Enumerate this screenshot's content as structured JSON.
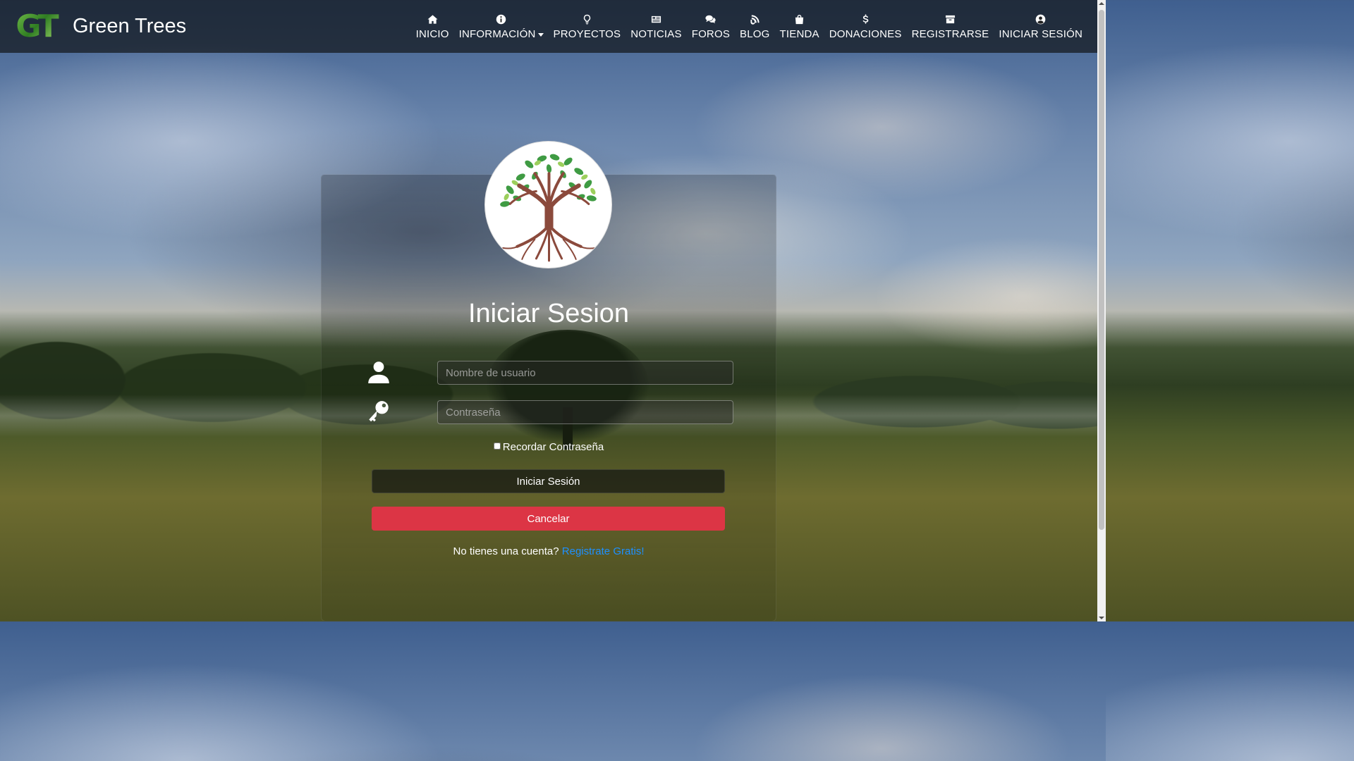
{
  "brand": {
    "logo_text": "GT",
    "name": "Green Trees"
  },
  "nav": {
    "items": [
      {
        "label": "INICIO",
        "icon": "home-icon"
      },
      {
        "label": "INFORMACIÓN",
        "icon": "info-icon",
        "dropdown": true
      },
      {
        "label": "PROYECTOS",
        "icon": "lightbulb-icon"
      },
      {
        "label": "NOTICIAS",
        "icon": "newspaper-icon"
      },
      {
        "label": "FOROS",
        "icon": "comments-icon"
      },
      {
        "label": "BLOG",
        "icon": "blog-icon"
      },
      {
        "label": "TIENDA",
        "icon": "shopping-bag-icon"
      },
      {
        "label": "DONACIONES",
        "icon": "dollar-icon"
      },
      {
        "label": "REGISTRARSE",
        "icon": "archive-icon"
      },
      {
        "label": "INICIAR SESIÓN",
        "icon": "user-circle-icon"
      }
    ]
  },
  "login": {
    "title": "Iniciar Sesion",
    "username_placeholder": "Nombre de usuario",
    "username_value": "",
    "password_placeholder": "Contraseña",
    "password_value": "",
    "remember_label": "Recordar Contraseña",
    "remember_checked": false,
    "submit_label": "Iniciar Sesión",
    "cancel_label": "Cancelar",
    "signup_prompt": "No tienes una cuenta?",
    "signup_link": "Registrate Gratis!"
  },
  "colors": {
    "cancel": "#dc3545",
    "link": "#1e90ff",
    "nav_bg": "#14181c"
  }
}
